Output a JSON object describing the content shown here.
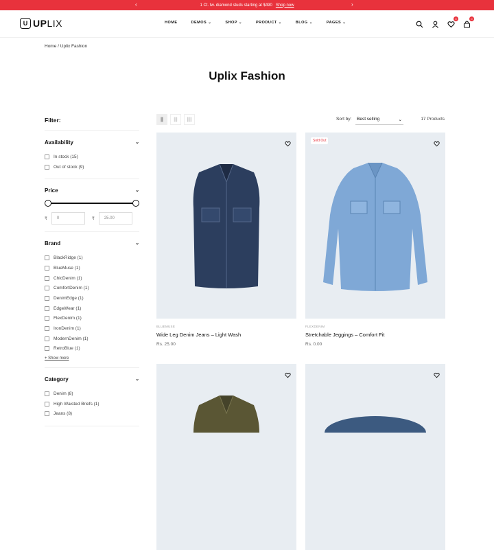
{
  "announcement": {
    "text": "1 Ct. tw. diamond studs starting at $490",
    "link": "Shop now"
  },
  "logo": {
    "mark": "U",
    "bold": "UP",
    "light": "LIX"
  },
  "nav": [
    "HOME",
    "DEMOS",
    "SHOP",
    "PRODUCT",
    "BLOG",
    "PAGES"
  ],
  "header_icons": {
    "wishlist_count": "0",
    "cart_count": "0"
  },
  "breadcrumb": "Home  /  Uplix Fashion",
  "page_title": "Uplix Fashion",
  "filter": {
    "heading": "Filter:",
    "availability": {
      "title": "Availability",
      "options": [
        "In stock (15)",
        "Out of stock (9)"
      ]
    },
    "price": {
      "title": "Price",
      "currency": "₹",
      "min": "0",
      "max": "25.00"
    },
    "brand": {
      "title": "Brand",
      "options": [
        "BlackRidge (1)",
        "BlueMuse (1)",
        "ChicDenim (1)",
        "ComfortDenim (1)",
        "DenimEdge (1)",
        "EdgeWear (1)",
        "FlexDenim (1)",
        "IronDenim (1)",
        "ModernDenim (1)",
        "RetroBlue (1)"
      ],
      "show_more": "+ Show more"
    },
    "category": {
      "title": "Category",
      "options": [
        "Denim (8)",
        "High Waisted Briefs (1)",
        "Jeans (8)"
      ]
    }
  },
  "toolbar": {
    "sort_label": "Sort by:",
    "sort_value": "Best selling",
    "count": "17 Products"
  },
  "products": [
    {
      "brand": "BLUEMUSE",
      "name": "Wide Leg Denim Jeans – Light Wash",
      "price": "Rs. 25.00",
      "badge": ""
    },
    {
      "brand": "FLEXDENIM",
      "name": "Stretchable Jeggings – Comfort Fit",
      "price": "Rs. 0.00",
      "badge": "Sold Out"
    }
  ],
  "colors": {
    "accent": "#e8323c",
    "card_bg": "#e8edf2"
  }
}
